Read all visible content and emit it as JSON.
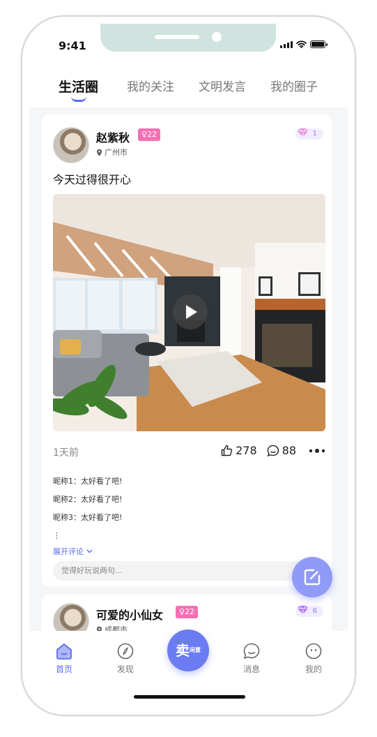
{
  "status_bar": {
    "time": "9:41"
  },
  "tabs": [
    {
      "label": "生活圈",
      "active": true
    },
    {
      "label": "我的关注"
    },
    {
      "label": "文明发言"
    },
    {
      "label": "我的圈子"
    }
  ],
  "posts": [
    {
      "user": "赵紫秋",
      "level": "22",
      "location": "广州市",
      "gem_count": "1",
      "text": "今天过得很开心",
      "time_ago": "1天前",
      "likes": "278",
      "comments_count": "88",
      "comments": [
        "昵称1：太好看了吧!",
        "昵称2：太好看了吧!",
        "昵称3：太好看了吧!"
      ],
      "more": "⋮",
      "expand_label": "展开评论",
      "input_placeholder": "觉得好玩说两句..."
    },
    {
      "user": "可爱的小仙女",
      "level": "22",
      "location": "成都市",
      "gem_count": "6"
    }
  ],
  "bottom_nav": [
    {
      "label": "首页",
      "icon": "home-icon",
      "active": true
    },
    {
      "label": "发现",
      "icon": "compass-icon"
    },
    {
      "label": "卖",
      "sub": "闲置",
      "icon": "sell-button"
    },
    {
      "label": "消息",
      "icon": "message-icon"
    },
    {
      "label": "我的",
      "icon": "profile-icon"
    }
  ],
  "colors": {
    "accent": "#5b6cf0",
    "level_badge": "#f56fb3",
    "gem": "#c884ff"
  }
}
